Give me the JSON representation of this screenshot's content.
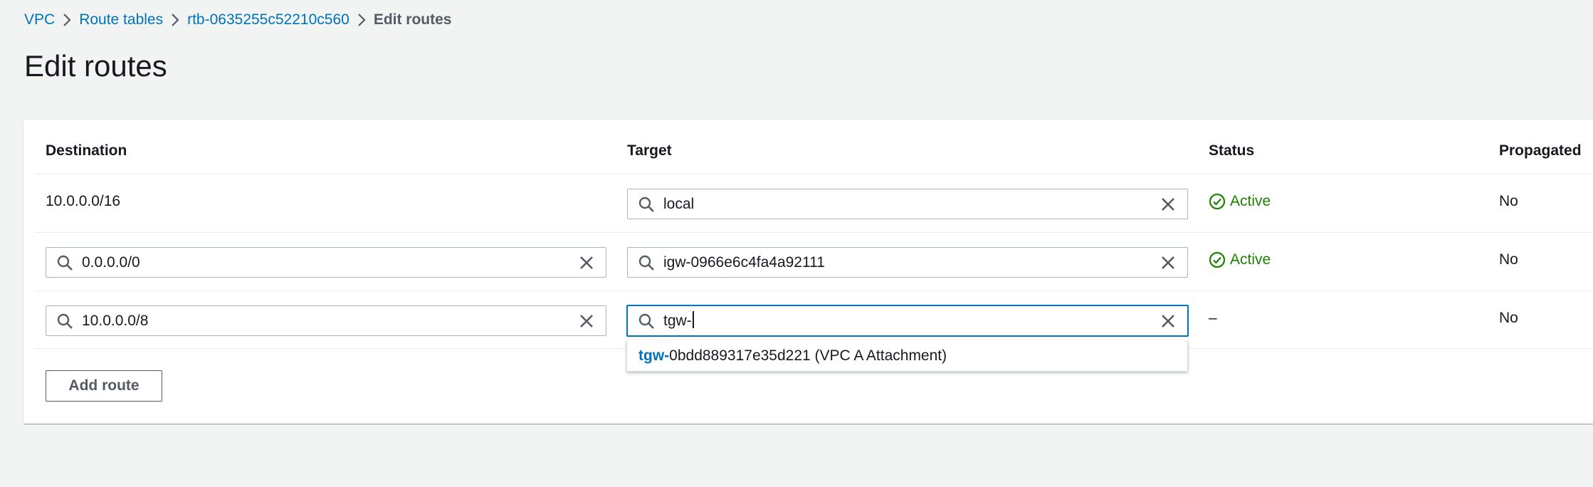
{
  "breadcrumb": {
    "items": [
      "VPC",
      "Route tables",
      "rtb-0635255c52210c560"
    ],
    "current": "Edit routes"
  },
  "page": {
    "title": "Edit routes"
  },
  "table": {
    "columns": [
      "Destination",
      "Target",
      "Status",
      "Propagated"
    ],
    "rows": [
      {
        "destination": "10.0.0.0/16",
        "target": "local",
        "status": "Active",
        "propagated": "No"
      },
      {
        "destination": "0.0.0.0/0",
        "target": "igw-0966e6c4fa4a92111",
        "status": "Active",
        "propagated": "No"
      },
      {
        "destination": "10.0.0.0/8",
        "target": "tgw-",
        "status": "–",
        "propagated": "No"
      }
    ]
  },
  "dropdown": {
    "match": "tgw-",
    "rest": "0bdd889317e35d221 (VPC A Attachment)"
  },
  "buttons": {
    "add_route": "Add route"
  },
  "colors": {
    "link": "#0073bb",
    "active": "#1d8102",
    "focus": "#0073bb",
    "background": "#f2f3f3"
  },
  "icons": {
    "search": "search-icon",
    "clear": "close-icon",
    "status": "check-circle-icon",
    "separator": "chevron-right-icon"
  }
}
